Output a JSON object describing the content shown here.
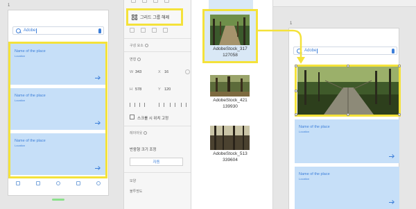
{
  "left_artboard": {
    "number": "1",
    "search": {
      "value": "Adobe"
    },
    "cards": [
      {
        "title": "Name of the place",
        "subtitle": "Location"
      },
      {
        "title": "Name of the place",
        "subtitle": "Location"
      },
      {
        "title": "Name of the place",
        "subtitle": "Location"
      }
    ]
  },
  "property_panel": {
    "ungroup_label": "그리드 그룹 해제",
    "component_label": "구성 요소",
    "transform_label": "변형",
    "w_key": "W",
    "w_value": "343",
    "x_key": "X",
    "x_value": "16",
    "h_key": "H",
    "h_value": "578",
    "y_key": "Y",
    "y_value": "120",
    "fix_scroll_label": "스크롤 시 위치 고정",
    "responsive_label": "반응형 크기 조정",
    "responsive_section": "레이아웃",
    "auto_label": "자동",
    "appearance_label": "모양",
    "opacity_label": "불투명도"
  },
  "assets_panel": {
    "items": [
      {
        "caption_line1": "AdobeStock_317",
        "caption_line2": "127058"
      },
      {
        "caption_line1": "AdobeStock_421",
        "caption_line2": "139930"
      },
      {
        "caption_line1": "AdobeStock_513",
        "caption_line2": "339604"
      }
    ]
  },
  "right_artboard": {
    "number": "1",
    "search": {
      "value": "Adobe"
    },
    "cards": [
      {
        "title": "Name of the place",
        "subtitle": "Location"
      },
      {
        "title": "Name of the place",
        "subtitle": "Location"
      }
    ]
  },
  "colors": {
    "accent": "#3d7fd9",
    "card_bg": "#c6dff8",
    "highlight": "#f4e23a"
  }
}
